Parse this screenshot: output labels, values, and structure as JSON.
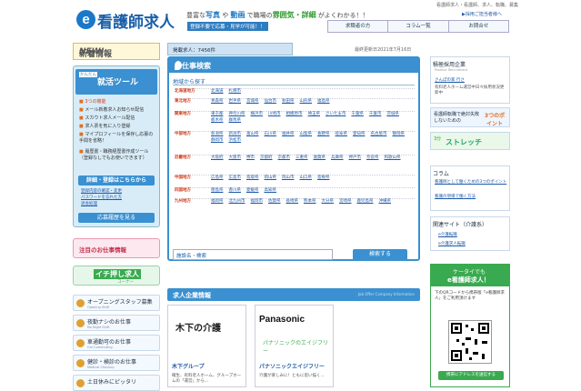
{
  "header": {
    "logo_text": "看護師求人",
    "tagline_1a": "豊富な",
    "tagline_1b": "写真",
    "tagline_1c": " や ",
    "tagline_1d": "動画",
    "tagline_1e": " で職場の",
    "tagline_1f": "雰囲気・詳細",
    "tagline_1g": " がよくわかる！！",
    "tagline_2": "登録不要で応募・見学が可能！！",
    "top_links": "看護師求人・看護師、求人、転職、募集",
    "favorite": "▶採用ご担当者様へ",
    "nav": [
      "求職者の方",
      "コラム一覧",
      "お問合せ"
    ]
  },
  "sidebar": {
    "new_info": "新着情報",
    "new_tag": "NEW!",
    "tool_title": "就活ツール",
    "tool_sub": "かんたん",
    "tool_items": [
      "3つの機能",
      "メール新着求人お知らせ配信",
      "スカウト求人メール配信",
      "求人票を気に入り登録",
      "マイプロフィールを保存し応募の手間を省略！",
      "履歴書・職務経歴書作成ツール（登録なしでもお使いできます）"
    ],
    "register": "詳細・登録はこちらから",
    "links": [
      "登録内容の確認・変更",
      "パスワードを忘れた方",
      "退会処理"
    ],
    "login": "応募履歴を見る",
    "job_banner": "注目のお仕事情報",
    "push_banner": "イチ押し求人",
    "push_sub": "コーナー",
    "menu": [
      {
        "t": "オープニングスタッフ募集",
        "s": "Opening Staff"
      },
      {
        "t": "夜勤ナシのお仕事",
        "s": "No Night Shift"
      },
      {
        "t": "車通勤可のお仕事",
        "s": "Car Commuting"
      },
      {
        "t": "健診・検診のお仕事",
        "s": "Medical Checkup"
      },
      {
        "t": "土日休みにピッタリ",
        "s": "Weekend Off"
      }
    ]
  },
  "content": {
    "count_label": "掲載求人：7456件",
    "updated": "最終更新日2021年7月16日",
    "search_title": "お仕事検索",
    "area_title": "地域から探す",
    "regions": [
      {
        "name": "北海道地方",
        "prefs": [
          "北海道",
          "札幌市"
        ]
      },
      {
        "name": "東北地方",
        "prefs": [
          "青森県",
          "岩手県",
          "宮城県",
          "仙台市",
          "秋田県",
          "山形県",
          "福島県"
        ]
      },
      {
        "name": "関東地方",
        "prefs": [
          "東京都",
          "神奈川県",
          "横浜市",
          "川崎市",
          "相模原市",
          "埼玉県",
          "さいたま市",
          "千葉県",
          "千葉市",
          "茨城県",
          "栃木県",
          "群馬県"
        ]
      },
      {
        "name": "中部地方",
        "prefs": [
          "新潟県",
          "新潟市",
          "富山県",
          "石川県",
          "福井県",
          "山梨県",
          "長野県",
          "岐阜県",
          "愛知県",
          "名古屋市",
          "静岡県",
          "静岡市",
          "浜松市"
        ]
      },
      {
        "name": "近畿地方",
        "prefs": [
          "大阪府",
          "大阪市",
          "堺市",
          "京都府",
          "京都市",
          "三重県",
          "滋賀県",
          "兵庫県",
          "神戸市",
          "奈良県",
          "和歌山県"
        ]
      },
      {
        "name": "中国地方",
        "prefs": [
          "広島県",
          "広島市",
          "鳥取県",
          "岡山県",
          "岡山市",
          "山口県",
          "島根県"
        ]
      },
      {
        "name": "四国地方",
        "prefs": [
          "徳島県",
          "香川県",
          "愛媛県",
          "高知県"
        ]
      },
      {
        "name": "九州地方",
        "prefs": [
          "福岡県",
          "北九州市",
          "福岡市",
          "佐賀県",
          "長崎県",
          "熊本県",
          "大分県",
          "宮崎県",
          "鹿児島県",
          "沖縄県"
        ]
      }
    ],
    "keyword_label": "施設名・検索",
    "search_button": "検索する",
    "feature_title": "求人企業情報",
    "feature_sub": "Job Offer Company Information",
    "cards": [
      {
        "name": "木下グループ",
        "logo": "木下の介護",
        "desc": "確生、有料老人ホーム、グループホームの「運営」から..."
      },
      {
        "name": "パナソニックエイジフリー",
        "logo": "Panasonic",
        "logo2": "パナソニックのエイジフリー",
        "desc": "介護が楽しみに！ともに思い描く..."
      }
    ]
  },
  "right": {
    "recruit_title": "積極採用企業",
    "recruit_sub": "Positive Recruitment",
    "company": "さんぽの家 行さ",
    "company_desc": "有料老人ホーム運営中日々採用状況更新中",
    "features_title": "看護師転職で絶対失敗しないための",
    "features_badge": "3つのポイント",
    "stretch": "ストレッチ",
    "stretch_num": "3分",
    "column_title": "コラム",
    "column_links": [
      "看護師として働くための3つのポイント",
      "看護の現場で働く方法"
    ],
    "related_title": "関連サイト（介護系）",
    "related_links": [
      "e介護転職",
      "e介護求人転職"
    ],
    "mobile_title": "ケータイでも",
    "mobile_title2": "e看護師求人！",
    "mobile_desc": "下のQRコードから携帯版「e看護師求人」をご利用頂けます",
    "send_url": "携帯にアドレスを送信する"
  },
  "colors": {
    "accent": "#3a90d0",
    "brand": "#1a5fa8",
    "alert": "#d04020"
  }
}
